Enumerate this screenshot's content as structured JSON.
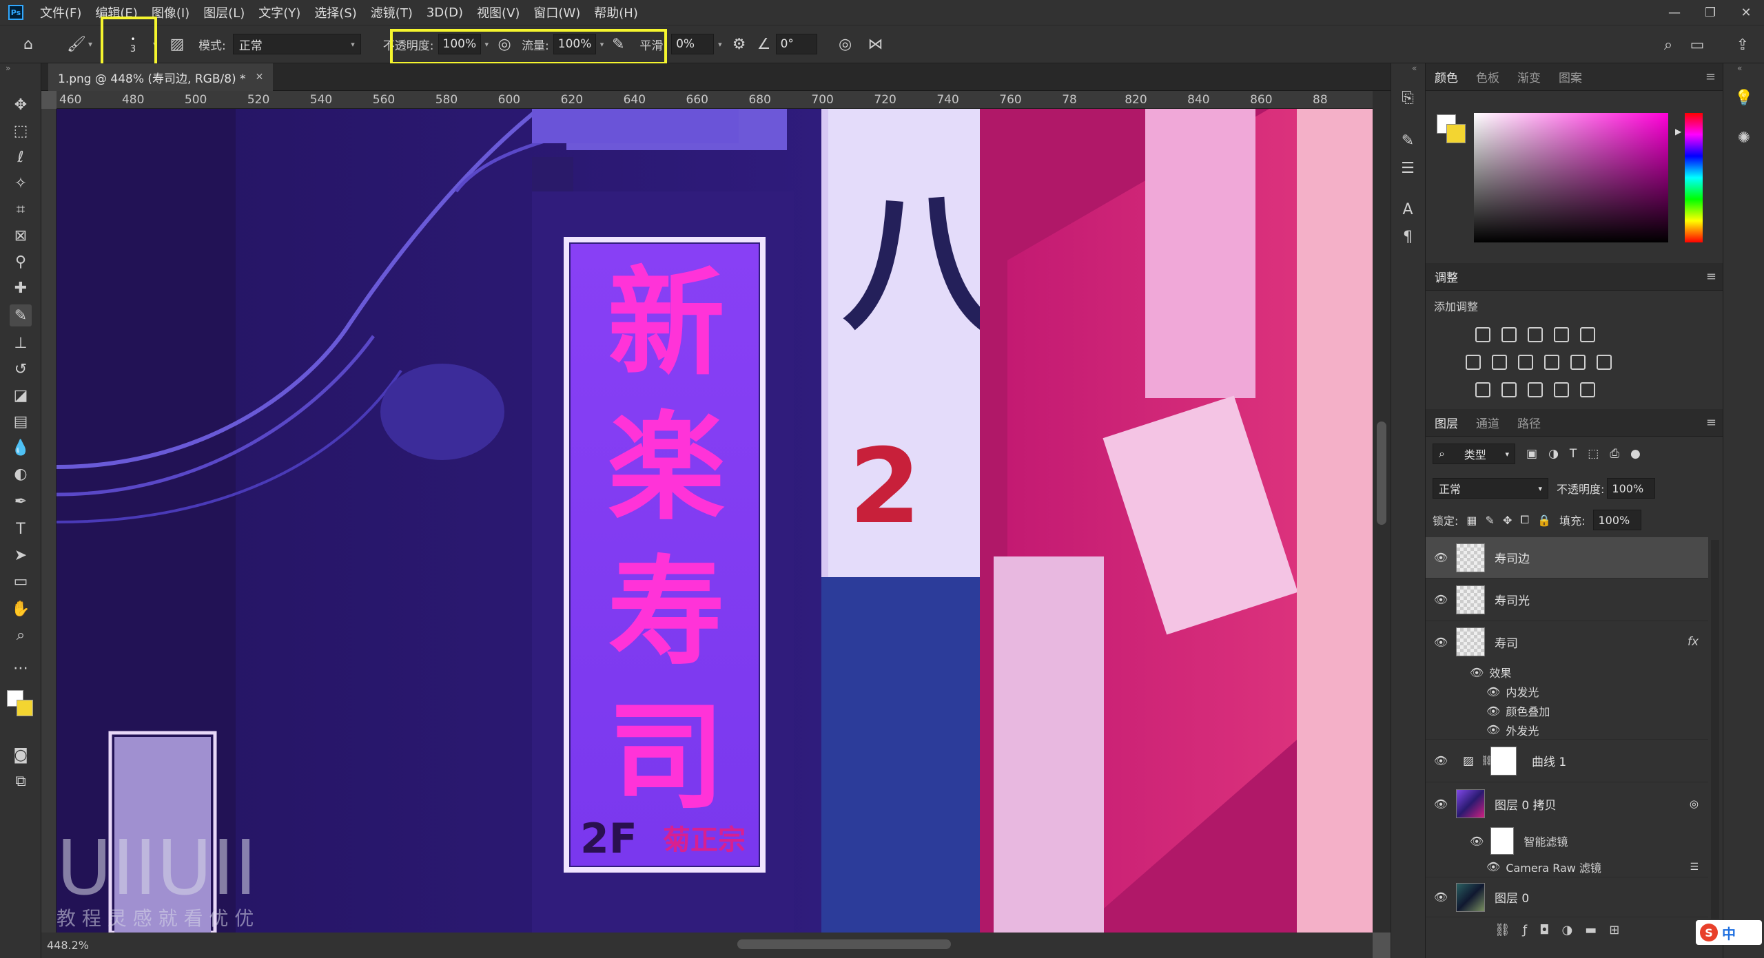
{
  "menubar": {
    "items": [
      "文件(F)",
      "编辑(E)",
      "图像(I)",
      "图层(L)",
      "文字(Y)",
      "选择(S)",
      "滤镜(T)",
      "3D(D)",
      "视图(V)",
      "窗口(W)",
      "帮助(H)"
    ]
  },
  "options": {
    "brush_size": "3",
    "mode_label": "模式:",
    "mode_value": "正常",
    "opacity_label": "不透明度:",
    "opacity_value": "100%",
    "flow_label": "流量:",
    "flow_value": "100%",
    "smooth_label": "平滑:",
    "smooth_value": "0%",
    "angle_value": "0°"
  },
  "document": {
    "tab_title": "1.png @ 448% (寿司边, RGB/8) *",
    "zoom": "448.2%"
  },
  "ruler": {
    "h_labels": [
      "460",
      "480",
      "500",
      "520",
      "540",
      "560",
      "580",
      "600",
      "620",
      "640",
      "660",
      "680",
      "700",
      "720",
      "740",
      "760",
      "78",
      "820",
      "840",
      "860",
      "88"
    ]
  },
  "canvas": {
    "sign_text": [
      "新",
      "楽",
      "寿",
      "司"
    ],
    "floor_text": "2F",
    "shop_text": "菊正宗",
    "number_text": "2",
    "watermark": "UIIUII",
    "watermark_sub": "教 程 灵 感 就 看 优 优"
  },
  "panels": {
    "color_tabs": [
      "颜色",
      "色板",
      "渐变",
      "图案"
    ],
    "adjust_title": "调整",
    "adjust_add": "添加调整",
    "layer_tabs": [
      "图层",
      "通道",
      "路径"
    ],
    "layer_filter": "类型",
    "blend_mode": "正常",
    "opacity_label": "不透明度:",
    "opacity_value": "100%",
    "lock_label": "锁定:",
    "fill_label": "填充:",
    "fill_value": "100%"
  },
  "layers": [
    {
      "name": "寿司边"
    },
    {
      "name": "寿司光"
    },
    {
      "name": "寿司"
    },
    {
      "name": "曲线 1"
    },
    {
      "name": "图层 0 拷贝"
    },
    {
      "name": "图层 0"
    }
  ],
  "effects": {
    "title": "效果",
    "items": [
      "内发光",
      "颜色叠加",
      "外发光"
    ],
    "fx": "fx"
  },
  "smart": {
    "title": "智能滤镜",
    "item": "Camera Raw 滤镜"
  },
  "ime": {
    "label": "中"
  }
}
